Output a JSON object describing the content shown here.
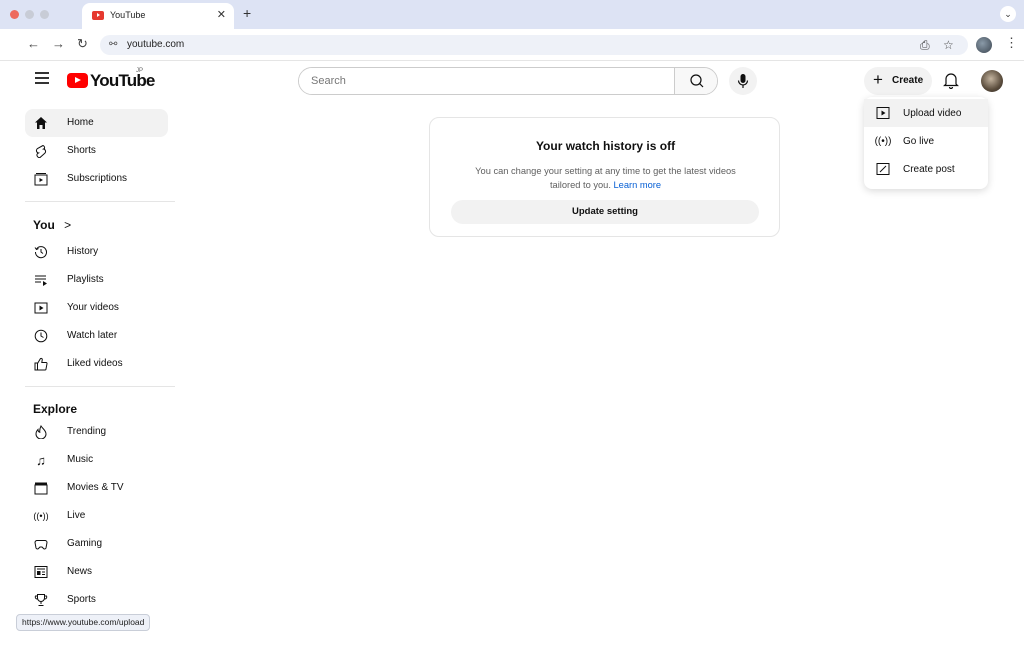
{
  "browser": {
    "tab_title": "YouTube",
    "url": "youtube.com",
    "status_url": "https://www.youtube.com/upload"
  },
  "header": {
    "logo_text": "YouTube",
    "logo_region": "JP",
    "search_placeholder": "Search",
    "create_label": "Create"
  },
  "create_menu": {
    "items": [
      {
        "label": "Upload video"
      },
      {
        "label": "Go live"
      },
      {
        "label": "Create post"
      }
    ]
  },
  "sidebar": {
    "main": [
      {
        "label": "Home"
      },
      {
        "label": "Shorts"
      },
      {
        "label": "Subscriptions"
      }
    ],
    "you_title": "You",
    "you_chevron": ">",
    "you": [
      {
        "label": "History"
      },
      {
        "label": "Playlists"
      },
      {
        "label": "Your videos"
      },
      {
        "label": "Watch later"
      },
      {
        "label": "Liked videos"
      }
    ],
    "explore_title": "Explore",
    "explore": [
      {
        "label": "Trending"
      },
      {
        "label": "Music"
      },
      {
        "label": "Movies & TV"
      },
      {
        "label": "Live"
      },
      {
        "label": "Gaming"
      },
      {
        "label": "News"
      },
      {
        "label": "Sports"
      }
    ]
  },
  "history_card": {
    "title": "Your watch history is off",
    "body": "You can change your setting at any time to get the latest videos tailored to you.",
    "link": "Learn more",
    "button": "Update setting"
  },
  "colors": {
    "brand_red": "#ff0000",
    "link_blue": "#065fd4",
    "chrome_frame": "#dde3f4"
  }
}
